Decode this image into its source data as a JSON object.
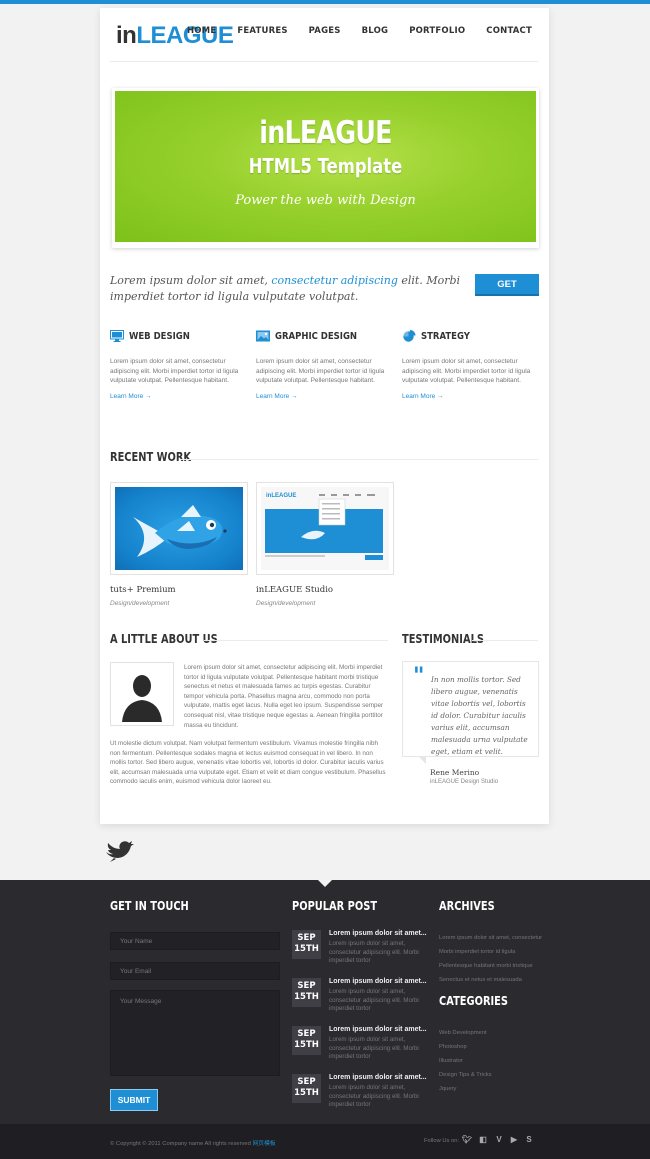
{
  "brand": {
    "logo_in": "in",
    "logo_league": "LEAGUE"
  },
  "nav": [
    "HOME",
    "FEATURES",
    "PAGES",
    "BLOG",
    "PORTFOLIO",
    "CONTACT"
  ],
  "hero": {
    "title": "inLEAGUE",
    "subtitle": "HTML5 Template",
    "tagline": "Power the web with Design"
  },
  "intro": {
    "pre": "Lorem ipsum dolor sit amet, ",
    "link": "consectetur adipiscing",
    "post": " elit. Morbi imperdiet tortor id ligula vulputate volutpat.",
    "button": "GET"
  },
  "features": [
    {
      "title": "WEB DESIGN",
      "icon": "monitor-icon",
      "text": "Lorem ipsum dolor sit amet, consectetur adipiscing elit. Morbi imperdiet tortor id ligula vulputate volutpat. Pellentesque habitant.",
      "more": "Learn More →"
    },
    {
      "title": "GRAPHIC DESIGN",
      "icon": "image-icon",
      "text": "Lorem ipsum dolor sit amet, consectetur adipiscing elit. Morbi imperdiet tortor id ligula vulputate volutpat. Pellentesque habitant.",
      "more": "Learn More →"
    },
    {
      "title": "STRATEGY",
      "icon": "pie-chart-icon",
      "text": "Lorem ipsum dolor sit amet, consectetur adipiscing elit. Morbi imperdiet tortor id ligula vulputate volutpat. Pellentesque habitant.",
      "more": "Learn More →"
    }
  ],
  "recent": {
    "title": "RECENT WORK",
    "items": [
      {
        "title": "tuts+ Premium",
        "sub": "Design/development"
      },
      {
        "title": "inLEAGUE Studio",
        "sub": "Design/development"
      }
    ]
  },
  "about": {
    "title": "A LITTLE ABOUT US",
    "p1": "Lorem ipsum dolor sit amet, consectetur adipiscing elit. Morbi imperdiet tortor id ligula vulputate volutpat. Pellentesque habitant morbi tristique senectus et netus et malesuada fames ac turpis egestas. Curabitur tempor vehicula porta. Phasellus magna arcu, commodo non porta vulputate, mattis eget lacus. Nulla eget leo ipsum. Suspendisse semper consequat nisl, vitae tristique neque egestas a. Aenean fringilla porttitor massa eu tincidunt.",
    "p2": "Ut molestie dictum volutpat. Nam volutpat fermentum vestibulum. Vivamus molestie fringilla nibh non fermentum. Pellentesque sodales magna et lectus euismod consequat in vel libero. In non mollis tortor. Sed libero augue, venenatis vitae lobortis vel, lobortis id dolor. Curabitur iaculis varius elit, accumsan malesuada urna vulputate eget. Etiam et velit et diam congue vestibulum. Phasellus commodo iaculis enim, euismod vehicula dolor laoreet eu."
  },
  "testimonials": {
    "title": "TESTIMONIALS",
    "quote": "In non mollis tortor. Sed libero augue, venenatis vitae lobortis vel, lobortis id dolor. Curabitur iaculis varius elit, accumsan malesuada urna vulputate eget, etiam et velit.",
    "name": "Rene Merino",
    "role": "inLEAGUE Design Studio"
  },
  "footer": {
    "get_in_touch": {
      "title": "GET IN TOUCH",
      "name_ph": "Your Name",
      "email_ph": "Your Email",
      "message_ph": "Your Message",
      "submit": "SUBMIT"
    },
    "popular": {
      "title": "POPULAR POST",
      "posts": [
        {
          "month": "SEP",
          "day": "15TH",
          "title": "Lorem ipsum dolor sit amet...",
          "text": "Lorem ipsum dolor sit amet, consectetur adipiscing elit. Morbi imperdiet tortor"
        },
        {
          "month": "SEP",
          "day": "15TH",
          "title": "Lorem ipsum dolor sit amet...",
          "text": "Lorem ipsum dolor sit amet, consectetur adipiscing elit. Morbi imperdiet tortor"
        },
        {
          "month": "SEP",
          "day": "15TH",
          "title": "Lorem ipsum dolor sit amet...",
          "text": "Lorem ipsum dolor sit amet, consectetur adipiscing elit. Morbi imperdiet tortor"
        },
        {
          "month": "SEP",
          "day": "15TH",
          "title": "Lorem ipsum dolor sit amet...",
          "text": "Lorem ipsum dolor sit amet, consectetur adipiscing elit. Morbi imperdiet tortor"
        }
      ]
    },
    "archives": {
      "title": "ARCHIVES",
      "items": [
        "Lorem ipsum dolor sit amet, consectetur",
        "Morbi imperdiet tortor id ligula",
        "Pellentesque habitant morbi tristique",
        "Senectus et netus et malesuada"
      ]
    },
    "categories": {
      "title": "CATEGORIES",
      "items": [
        "Web Development",
        "Photoshop",
        "Illustrator",
        "Design Tips & Tricks",
        "Jquery"
      ]
    },
    "copyright": "© Copyright © 2011 Company name All rights reserved",
    "copyright_cn": "网页模板",
    "follow": "Follow Us on:"
  },
  "colors": {
    "accent": "#1e8fd4",
    "hero_green": "#8cca2a",
    "footer_bg": "#2a2a2f"
  }
}
